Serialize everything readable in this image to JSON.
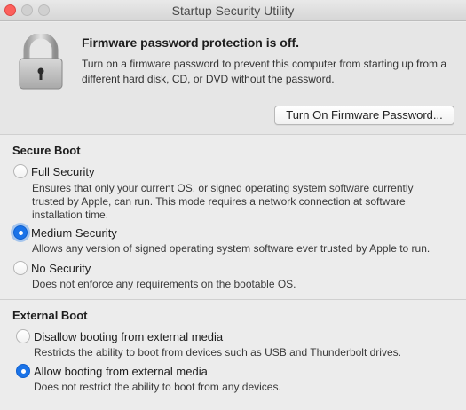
{
  "window": {
    "title": "Startup Security Utility"
  },
  "firmware": {
    "heading": "Firmware password protection is off.",
    "description": "Turn on a firmware password to prevent this computer from starting up from a different hard disk, CD, or DVD without the password.",
    "button_label": "Turn On Firmware Password..."
  },
  "secure_boot": {
    "heading": "Secure Boot",
    "options": [
      {
        "label": "Full Security",
        "description": "Ensures that only your current OS, or signed operating system software currently trusted by Apple, can run. This mode requires a network connection at software installation time.",
        "selected": false
      },
      {
        "label": "Medium Security",
        "description": "Allows any version of signed operating system software ever trusted by Apple to run.",
        "selected": true
      },
      {
        "label": "No Security",
        "description": "Does not enforce any requirements on the bootable OS.",
        "selected": false
      }
    ]
  },
  "external_boot": {
    "heading": "External Boot",
    "options": [
      {
        "label": "Disallow booting from external media",
        "description": "Restricts the ability to boot from devices such as USB and Thunderbolt drives.",
        "selected": false
      },
      {
        "label": "Allow booting from external media",
        "description": "Does not restrict the ability to boot from any devices.",
        "selected": true
      }
    ]
  },
  "colors": {
    "accent": "#1a73e8",
    "close_button": "#fc605c"
  },
  "icons": [
    "lock-icon",
    "close-window-icon",
    "minimize-window-icon",
    "zoom-window-icon"
  ]
}
